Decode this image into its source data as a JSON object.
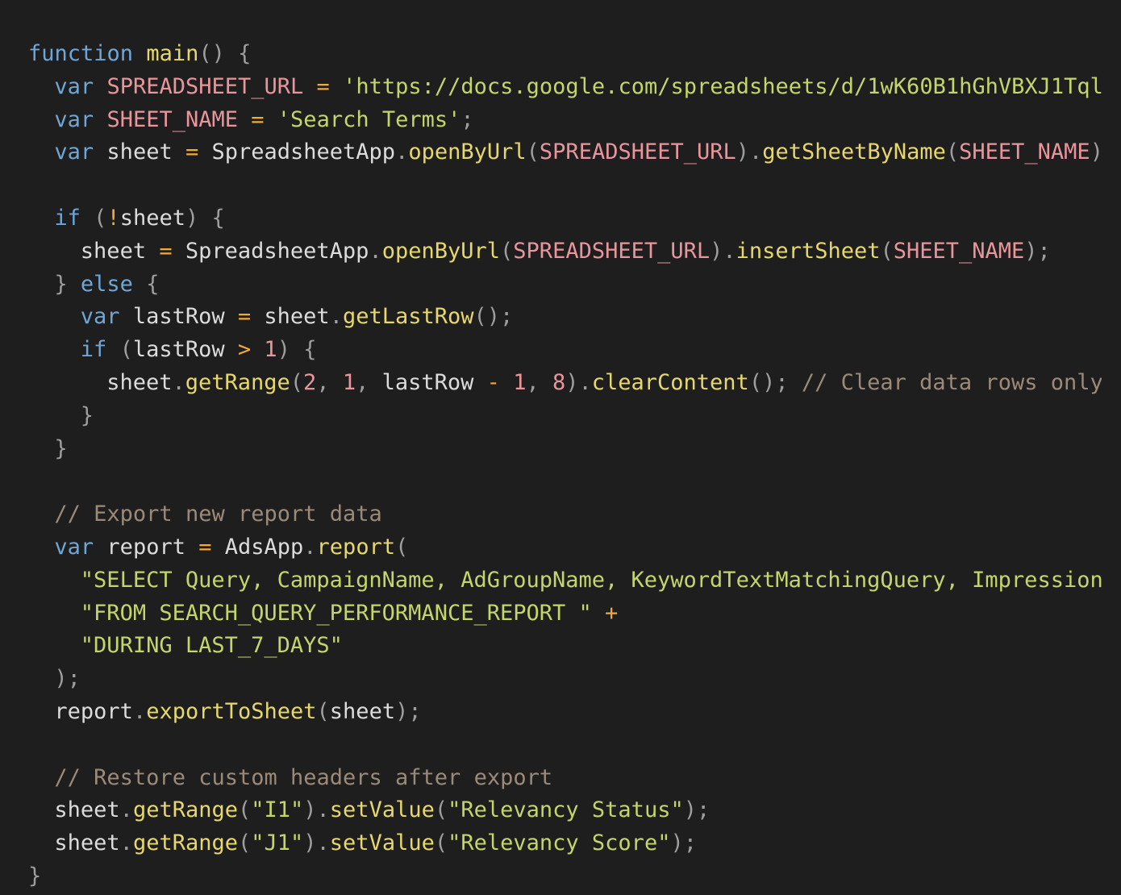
{
  "editor": {
    "background": "#1f1e1f",
    "colors": {
      "keyword": "#6fa6d6",
      "function": "#e6d86b",
      "string": "#c2d66a",
      "constant": "#e8969c",
      "operator": "#f2a93a",
      "comment": "#9b8a78",
      "identifier": "#dcdcdc",
      "punctuation": "#9e9e9e"
    },
    "lines": [
      {
        "indent": 1,
        "tokens": [
          {
            "type": "kw",
            "text": "function"
          },
          {
            "type": "id",
            "text": " "
          },
          {
            "type": "fn",
            "text": "main"
          },
          {
            "type": "pun",
            "text": "() {"
          }
        ]
      },
      {
        "indent": 2,
        "tokens": [
          {
            "type": "kw",
            "text": "var"
          },
          {
            "type": "id",
            "text": " "
          },
          {
            "type": "const",
            "text": "SPREADSHEET_URL"
          },
          {
            "type": "id",
            "text": " "
          },
          {
            "type": "op",
            "text": "="
          },
          {
            "type": "id",
            "text": " "
          },
          {
            "type": "str",
            "text": "'https://docs.google.com/spreadsheets/d/1wK60B1hGhVBXJ1Tql"
          }
        ]
      },
      {
        "indent": 2,
        "tokens": [
          {
            "type": "kw",
            "text": "var"
          },
          {
            "type": "id",
            "text": " "
          },
          {
            "type": "const",
            "text": "SHEET_NAME"
          },
          {
            "type": "id",
            "text": " "
          },
          {
            "type": "op",
            "text": "="
          },
          {
            "type": "id",
            "text": " "
          },
          {
            "type": "str",
            "text": "'Search Terms'"
          },
          {
            "type": "pun",
            "text": ";"
          }
        ]
      },
      {
        "indent": 2,
        "tokens": [
          {
            "type": "kw",
            "text": "var"
          },
          {
            "type": "id",
            "text": " sheet "
          },
          {
            "type": "op",
            "text": "="
          },
          {
            "type": "id",
            "text": " SpreadsheetApp"
          },
          {
            "type": "pun",
            "text": "."
          },
          {
            "type": "fn",
            "text": "openByUrl"
          },
          {
            "type": "pun",
            "text": "("
          },
          {
            "type": "const",
            "text": "SPREADSHEET_URL"
          },
          {
            "type": "pun",
            "text": ")."
          },
          {
            "type": "fn",
            "text": "getSheetByName"
          },
          {
            "type": "pun",
            "text": "("
          },
          {
            "type": "const",
            "text": "SHEET_NAME"
          },
          {
            "type": "pun",
            "text": ")"
          }
        ]
      },
      {
        "indent": 0,
        "tokens": []
      },
      {
        "indent": 2,
        "tokens": [
          {
            "type": "kw",
            "text": "if"
          },
          {
            "type": "id",
            "text": " "
          },
          {
            "type": "pun",
            "text": "("
          },
          {
            "type": "op",
            "text": "!"
          },
          {
            "type": "id",
            "text": "sheet"
          },
          {
            "type": "pun",
            "text": ") {"
          }
        ]
      },
      {
        "indent": 3,
        "tokens": [
          {
            "type": "id",
            "text": "sheet "
          },
          {
            "type": "op",
            "text": "="
          },
          {
            "type": "id",
            "text": " SpreadsheetApp"
          },
          {
            "type": "pun",
            "text": "."
          },
          {
            "type": "fn",
            "text": "openByUrl"
          },
          {
            "type": "pun",
            "text": "("
          },
          {
            "type": "const",
            "text": "SPREADSHEET_URL"
          },
          {
            "type": "pun",
            "text": ")."
          },
          {
            "type": "fn",
            "text": "insertSheet"
          },
          {
            "type": "pun",
            "text": "("
          },
          {
            "type": "const",
            "text": "SHEET_NAME"
          },
          {
            "type": "pun",
            "text": ");"
          }
        ]
      },
      {
        "indent": 2,
        "tokens": [
          {
            "type": "pun",
            "text": "} "
          },
          {
            "type": "kw",
            "text": "else"
          },
          {
            "type": "pun",
            "text": " {"
          }
        ]
      },
      {
        "indent": 3,
        "tokens": [
          {
            "type": "kw",
            "text": "var"
          },
          {
            "type": "id",
            "text": " lastRow "
          },
          {
            "type": "op",
            "text": "="
          },
          {
            "type": "id",
            "text": " sheet"
          },
          {
            "type": "pun",
            "text": "."
          },
          {
            "type": "fn",
            "text": "getLastRow"
          },
          {
            "type": "pun",
            "text": "();"
          }
        ]
      },
      {
        "indent": 3,
        "tokens": [
          {
            "type": "kw",
            "text": "if"
          },
          {
            "type": "id",
            "text": " "
          },
          {
            "type": "pun",
            "text": "("
          },
          {
            "type": "id",
            "text": "lastRow "
          },
          {
            "type": "op",
            "text": ">"
          },
          {
            "type": "id",
            "text": " "
          },
          {
            "type": "num",
            "text": "1"
          },
          {
            "type": "pun",
            "text": ") {"
          }
        ]
      },
      {
        "indent": 4,
        "tokens": [
          {
            "type": "id",
            "text": "sheet"
          },
          {
            "type": "pun",
            "text": "."
          },
          {
            "type": "fn",
            "text": "getRange"
          },
          {
            "type": "pun",
            "text": "("
          },
          {
            "type": "num",
            "text": "2"
          },
          {
            "type": "pun",
            "text": ", "
          },
          {
            "type": "num",
            "text": "1"
          },
          {
            "type": "pun",
            "text": ", "
          },
          {
            "type": "id",
            "text": "lastRow "
          },
          {
            "type": "op",
            "text": "-"
          },
          {
            "type": "id",
            "text": " "
          },
          {
            "type": "num",
            "text": "1"
          },
          {
            "type": "pun",
            "text": ", "
          },
          {
            "type": "num",
            "text": "8"
          },
          {
            "type": "pun",
            "text": ")."
          },
          {
            "type": "fn",
            "text": "clearContent"
          },
          {
            "type": "pun",
            "text": "(); "
          },
          {
            "type": "cm",
            "text": "// Clear data rows only"
          }
        ]
      },
      {
        "indent": 3,
        "tokens": [
          {
            "type": "pun",
            "text": "}"
          }
        ]
      },
      {
        "indent": 2,
        "tokens": [
          {
            "type": "pun",
            "text": "}"
          }
        ]
      },
      {
        "indent": 0,
        "tokens": []
      },
      {
        "indent": 2,
        "tokens": [
          {
            "type": "cm",
            "text": "// Export new report data"
          }
        ]
      },
      {
        "indent": 2,
        "tokens": [
          {
            "type": "kw",
            "text": "var"
          },
          {
            "type": "id",
            "text": " report "
          },
          {
            "type": "op",
            "text": "="
          },
          {
            "type": "id",
            "text": " AdsApp"
          },
          {
            "type": "pun",
            "text": "."
          },
          {
            "type": "fn",
            "text": "report"
          },
          {
            "type": "pun",
            "text": "("
          }
        ]
      },
      {
        "indent": 3,
        "tokens": [
          {
            "type": "str",
            "text": "\"SELECT Query, CampaignName, AdGroupName, KeywordTextMatchingQuery, Impressions"
          }
        ]
      },
      {
        "indent": 3,
        "tokens": [
          {
            "type": "str",
            "text": "\"FROM SEARCH_QUERY_PERFORMANCE_REPORT \""
          },
          {
            "type": "id",
            "text": " "
          },
          {
            "type": "op",
            "text": "+"
          }
        ]
      },
      {
        "indent": 3,
        "tokens": [
          {
            "type": "str",
            "text": "\"DURING LAST_7_DAYS\""
          }
        ]
      },
      {
        "indent": 2,
        "tokens": [
          {
            "type": "pun",
            "text": ");"
          }
        ]
      },
      {
        "indent": 2,
        "tokens": [
          {
            "type": "id",
            "text": "report"
          },
          {
            "type": "pun",
            "text": "."
          },
          {
            "type": "fn",
            "text": "exportToSheet"
          },
          {
            "type": "pun",
            "text": "("
          },
          {
            "type": "id",
            "text": "sheet"
          },
          {
            "type": "pun",
            "text": ");"
          }
        ]
      },
      {
        "indent": 0,
        "tokens": []
      },
      {
        "indent": 2,
        "tokens": [
          {
            "type": "cm",
            "text": "// Restore custom headers after export"
          }
        ]
      },
      {
        "indent": 2,
        "tokens": [
          {
            "type": "id",
            "text": "sheet"
          },
          {
            "type": "pun",
            "text": "."
          },
          {
            "type": "fn",
            "text": "getRange"
          },
          {
            "type": "pun",
            "text": "("
          },
          {
            "type": "str",
            "text": "\"I1\""
          },
          {
            "type": "pun",
            "text": ")."
          },
          {
            "type": "fn",
            "text": "setValue"
          },
          {
            "type": "pun",
            "text": "("
          },
          {
            "type": "str",
            "text": "\"Relevancy Status\""
          },
          {
            "type": "pun",
            "text": ");"
          }
        ]
      },
      {
        "indent": 2,
        "tokens": [
          {
            "type": "id",
            "text": "sheet"
          },
          {
            "type": "pun",
            "text": "."
          },
          {
            "type": "fn",
            "text": "getRange"
          },
          {
            "type": "pun",
            "text": "("
          },
          {
            "type": "str",
            "text": "\"J1\""
          },
          {
            "type": "pun",
            "text": ")."
          },
          {
            "type": "fn",
            "text": "setValue"
          },
          {
            "type": "pun",
            "text": "("
          },
          {
            "type": "str",
            "text": "\"Relevancy Score\""
          },
          {
            "type": "pun",
            "text": ");"
          }
        ]
      },
      {
        "indent": 1,
        "tokens": [
          {
            "type": "pun",
            "text": "}"
          }
        ]
      }
    ]
  }
}
